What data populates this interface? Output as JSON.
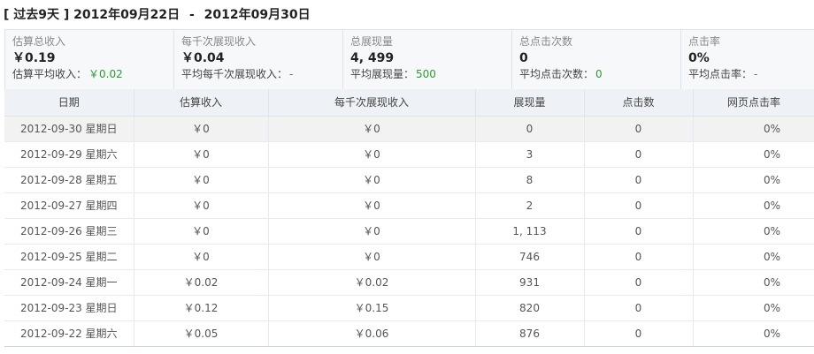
{
  "header": {
    "range_tag": "[ 过去9天 ]",
    "start_date": "2012年09月22日",
    "separator": "-",
    "end_date": "2012年09月30日"
  },
  "summary": [
    {
      "label": "估算总收入",
      "value": "￥0.19",
      "sub_label": "估算平均收入：",
      "sub_value": "￥0.02"
    },
    {
      "label": "每千次展现收入",
      "value": "￥0.04",
      "sub_label": "平均每千次展现收入：",
      "sub_value": "-"
    },
    {
      "label": "总展现量",
      "value": "4, 499",
      "sub_label": "平均展现量：",
      "sub_value": "500"
    },
    {
      "label": "总点击次数",
      "value": "0",
      "sub_label": "平均点击次数：",
      "sub_value": "0"
    },
    {
      "label": "点击率",
      "value": "0%",
      "sub_label": "平均点击率：",
      "sub_value": "-"
    }
  ],
  "table": {
    "columns": [
      "日期",
      "估算收入",
      "每千次展现收入",
      "展现量",
      "点击数",
      "网页点击率"
    ],
    "rows": [
      {
        "date": "2012-09-30 星期日",
        "revenue": "￥0",
        "rpm": "￥0",
        "impressions": "0",
        "clicks": "0",
        "ctr": "0%"
      },
      {
        "date": "2012-09-29 星期六",
        "revenue": "￥0",
        "rpm": "￥0",
        "impressions": "3",
        "clicks": "0",
        "ctr": "0%"
      },
      {
        "date": "2012-09-28 星期五",
        "revenue": "￥0",
        "rpm": "￥0",
        "impressions": "8",
        "clicks": "0",
        "ctr": "0%"
      },
      {
        "date": "2012-09-27 星期四",
        "revenue": "￥0",
        "rpm": "￥0",
        "impressions": "2",
        "clicks": "0",
        "ctr": "0%"
      },
      {
        "date": "2012-09-26 星期三",
        "revenue": "￥0",
        "rpm": "￥0",
        "impressions": "1, 113",
        "clicks": "0",
        "ctr": "0%"
      },
      {
        "date": "2012-09-25 星期二",
        "revenue": "￥0",
        "rpm": "￥0",
        "impressions": "746",
        "clicks": "0",
        "ctr": "0%"
      },
      {
        "date": "2012-09-24 星期一",
        "revenue": "￥0.02",
        "rpm": "￥0.02",
        "impressions": "931",
        "clicks": "0",
        "ctr": "0%"
      },
      {
        "date": "2012-09-23 星期日",
        "revenue": "￥0.12",
        "rpm": "￥0.15",
        "impressions": "820",
        "clicks": "0",
        "ctr": "0%"
      },
      {
        "date": "2012-09-22 星期六",
        "revenue": "￥0.05",
        "rpm": "￥0.06",
        "impressions": "876",
        "clicks": "0",
        "ctr": "0%"
      }
    ]
  },
  "colors": {
    "highlight_green": "#2e9a2e",
    "header_bg": "#eef1f5",
    "summary_bg": "#f6f8fa"
  }
}
